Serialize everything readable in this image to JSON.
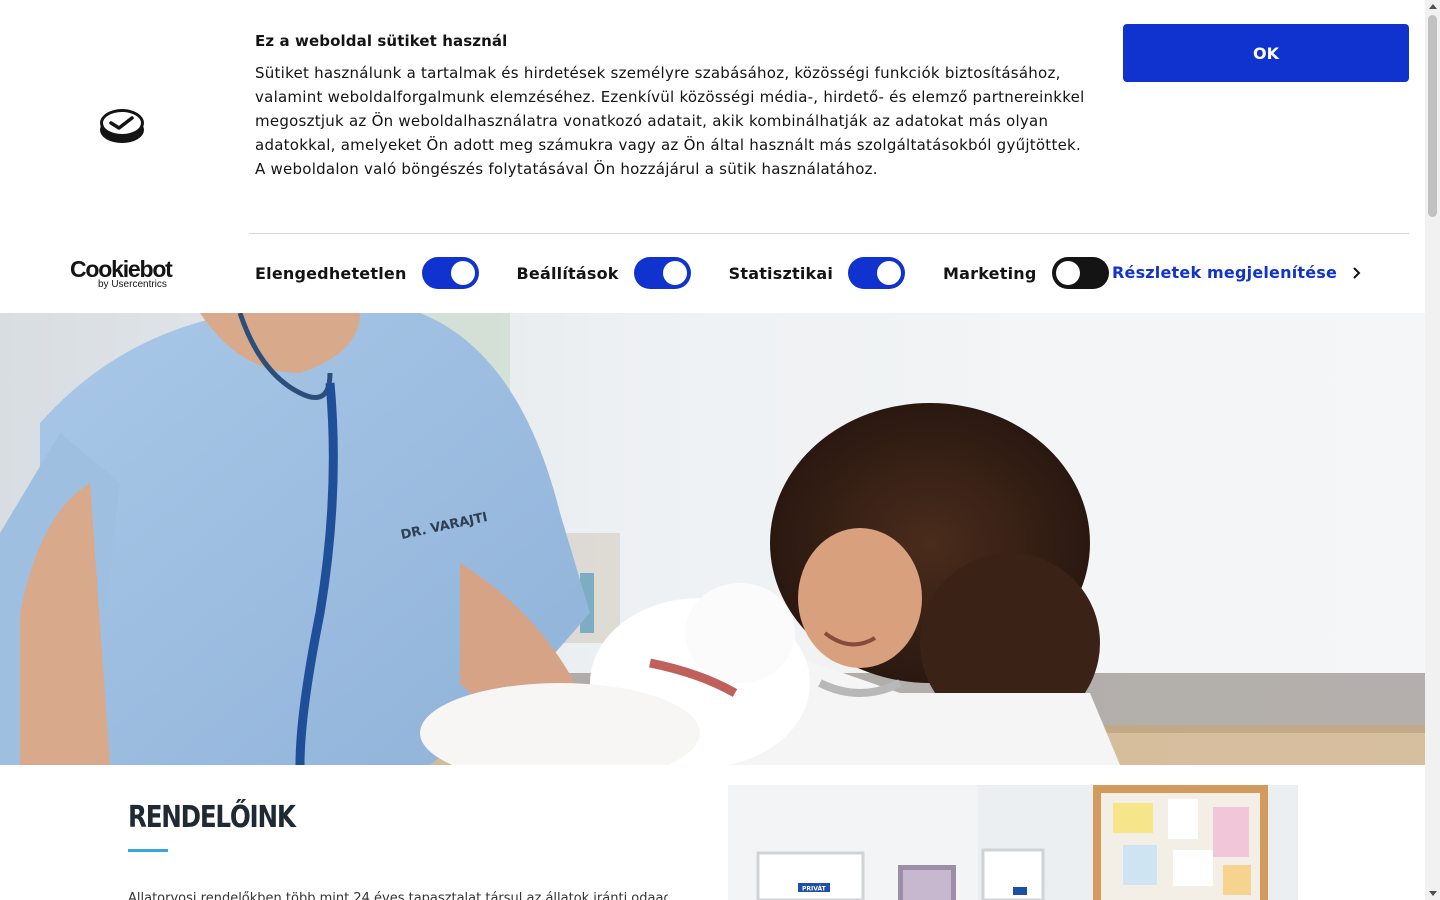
{
  "cookie_banner": {
    "title": "Ez a weboldal sütiket használ",
    "text": "Sütiket használunk a tartalmak és hirdetések személyre szabásához, közösségi funkciók biztosításához, valamint weboldalforgalmunk elemzéséhez. Ezenkívül közösségi média-, hirdető- és elemző partnereinkkel megosztjuk az Ön weboldalhasználatra vonatkozó adatait, akik kombinálhatják az adatokat más olyan adatokkal, amelyeket Ön adott meg számukra vagy az Ön által használt más szolgáltatásokból gyűjtöttek. A weboldalon való böngészés folytatásával Ön hozzájárul a sütik használatához.",
    "ok_label": "OK",
    "brand": {
      "name": "Cookiebot",
      "sub": "by Usercentrics"
    },
    "toggles": [
      {
        "label": "Elengedhetetlen",
        "checked": true
      },
      {
        "label": "Beállítások",
        "checked": true
      },
      {
        "label": "Statisztikai",
        "checked": true
      },
      {
        "label": "Marketing",
        "checked": false
      }
    ],
    "details_label": "Részletek megjelenítése",
    "accent_color": "#1032cf"
  },
  "hero": {
    "badge_text": "DR. VARAJTI"
  },
  "content": {
    "title": "RENDELŐINK",
    "text": "Állatorvosi rendelőkben több mint 24 éves tapasztalat társul az állatok iránti odaadó",
    "accent_color": "#36a6dc"
  },
  "clinic_photo": {
    "door_sign_text": "PRIVÁT"
  }
}
